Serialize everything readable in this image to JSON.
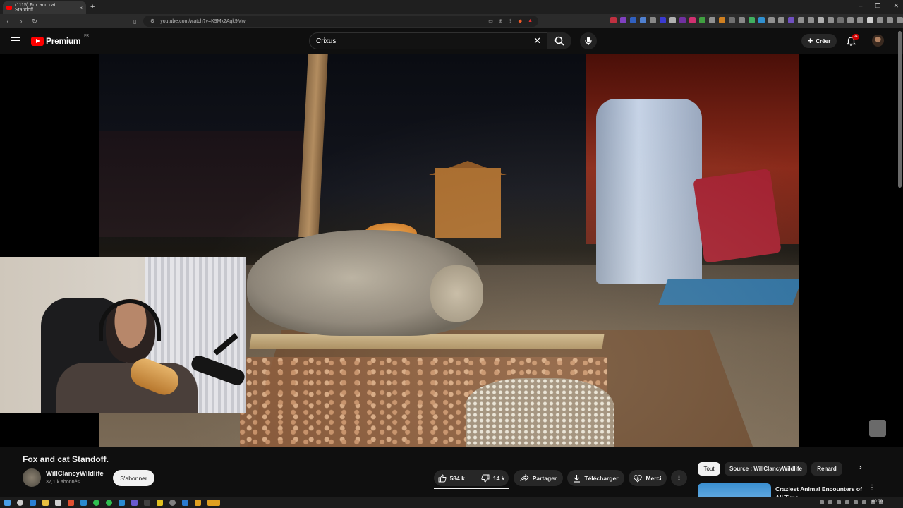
{
  "browser": {
    "tab_title": "(1115) Fox and cat Standoff.",
    "url": "youtube.com/watch?v=K9Mk2Aqk9Mw",
    "close_glyph": "×",
    "new_tab_glyph": "+",
    "win_minimize": "–",
    "win_restore": "❐",
    "win_close": "✕"
  },
  "header": {
    "logo_text": "Premium",
    "logo_region": "FR",
    "search_value": "Crixus",
    "create_label": "Créer",
    "notif_badge": "9+"
  },
  "video": {
    "title": "Fox and cat Standoff."
  },
  "channel": {
    "name": "WillClancyWildlife",
    "subscribers": "37,1 k abonnés",
    "subscribe_label": "S'abonner"
  },
  "actions": {
    "likes": "584 k",
    "dislikes": "14 k",
    "share_label": "Partager",
    "download_label": "Télécharger",
    "thanks_label": "Merci",
    "more_glyph": "⋮"
  },
  "chips": {
    "all": "Tout",
    "source": "Source : WillClancyWildlife",
    "fox": "Renard",
    "next_glyph": "›"
  },
  "recommendation": {
    "title": "Craziest Animal Encounters of All Time",
    "more_glyph": "⋮"
  },
  "taskbar": {
    "time": "00:00"
  },
  "colors": {
    "brand_red": "#ff0000",
    "background": "#0f0f0f",
    "pill": "#272727"
  }
}
